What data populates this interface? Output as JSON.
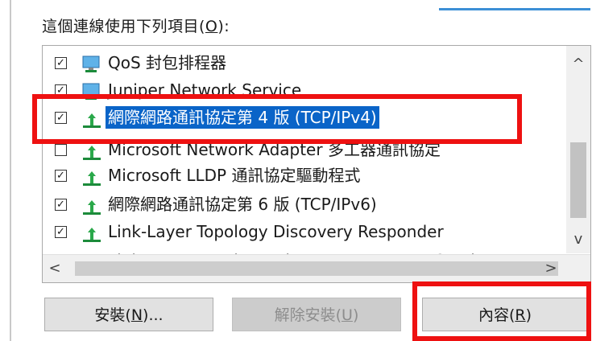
{
  "caption": {
    "text": "這個連線使用下列項目(",
    "accel": "O",
    "suffix": "):"
  },
  "items": [
    {
      "label": "QoS 封包排程器",
      "checked": true,
      "icon": "network-scheduler-icon"
    },
    {
      "label": "Juniper Network Service",
      "checked": true,
      "icon": "network-service-icon"
    },
    {
      "label": "網際網路通訊協定第 4 版 (TCP/IPv4)",
      "checked": true,
      "icon": "protocol-icon",
      "selected": true
    },
    {
      "label": "Microsoft Network Adapter 多工器通訊協定",
      "checked": false,
      "icon": "protocol-icon"
    },
    {
      "label": "Microsoft LLDP 通訊協定驅動程式",
      "checked": true,
      "icon": "protocol-icon"
    },
    {
      "label": "網際網路通訊協定第 6 版 (TCP/IPv6)",
      "checked": true,
      "icon": "protocol-icon"
    },
    {
      "label": "Link-Layer Topology Discovery Responder",
      "checked": true,
      "icon": "protocol-icon"
    },
    {
      "label": "Link-Layer Topology Discovery Mapper I/O Driver",
      "checked": true,
      "icon": "protocol-icon"
    }
  ],
  "scroll": {
    "up": "^",
    "down": "v",
    "left": "<",
    "right": ">"
  },
  "buttons": {
    "install": {
      "text": "安裝(",
      "accel": "N",
      "suffix": ")..."
    },
    "uninstall": {
      "text": "解除安裝(",
      "accel": "U",
      "suffix": ")"
    },
    "properties": {
      "text": "內容(",
      "accel": "R",
      "suffix": ")"
    }
  },
  "colors": {
    "highlight": "#ee1111",
    "selection": "#0a64c8"
  }
}
